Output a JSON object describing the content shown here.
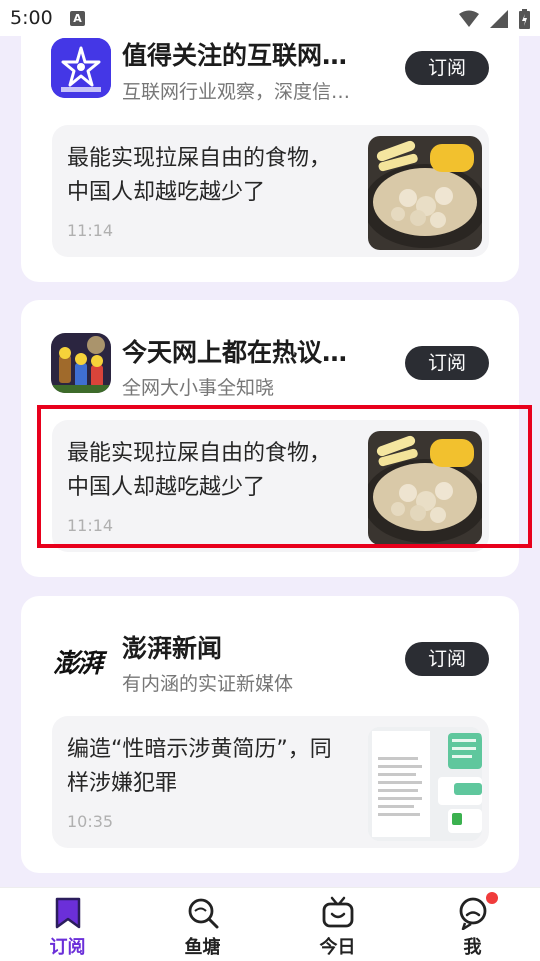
{
  "status_bar": {
    "time": "5:00",
    "notification_icon": "A"
  },
  "colors": {
    "accent": "#6b2fd9",
    "subscribe_bg": "#2b2d33",
    "highlight": "#e8001c",
    "badge": "#f03b3b"
  },
  "cards": [
    {
      "name": "值得关注的互联网…",
      "description": "互联网行业观察，深度信…",
      "subscribe_label": "订阅",
      "article": {
        "title": "最能实现拉屎自由的食物，中国人却越吃越少了",
        "time": "11:14"
      }
    },
    {
      "name": "今天网上都在热议…",
      "description": "全网大小事全知晓",
      "subscribe_label": "订阅",
      "article": {
        "title": "最能实现拉屎自由的食物，中国人却越吃越少了",
        "time": "11:14"
      }
    },
    {
      "name": "澎湃新闻",
      "description": "有内涵的实证新媒体",
      "logo_text": "澎湃",
      "subscribe_label": "订阅",
      "article": {
        "title": "编造“性暗示涉黄简历”，同样涉嫌犯罪",
        "time": "10:35"
      }
    }
  ],
  "tabbar": {
    "tabs": [
      {
        "label": "订阅",
        "icon": "bookmark-icon"
      },
      {
        "label": "鱼塘",
        "icon": "search-pond-icon"
      },
      {
        "label": "今日",
        "icon": "tv-icon"
      },
      {
        "label": "我",
        "icon": "profile-chat-icon"
      }
    ]
  }
}
